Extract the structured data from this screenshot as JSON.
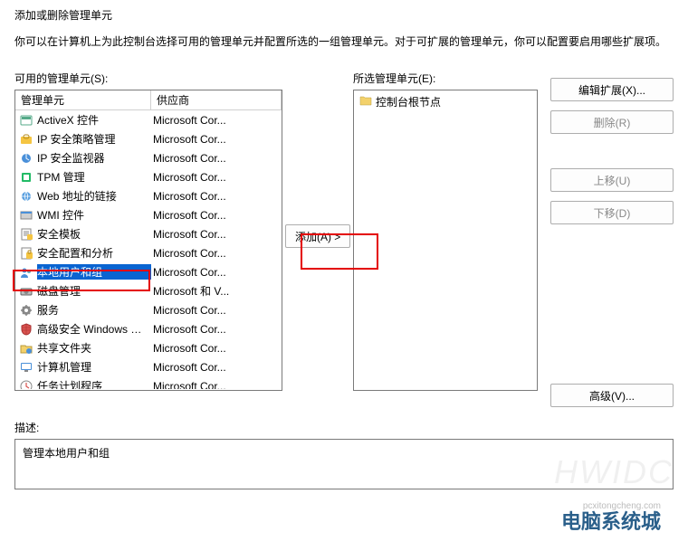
{
  "window_title": "添加或删除管理单元",
  "intro_text": "你可以在计算机上为此控制台选择可用的管理单元并配置所选的一组管理单元。对于可扩展的管理单元，你可以配置要启用哪些扩展项。",
  "labels": {
    "available": "可用的管理单元(S):",
    "selected": "所选管理单元(E):",
    "header_name": "管理单元",
    "header_vendor": "供应商",
    "add_button": "添加(A) >",
    "edit_ext": "编辑扩展(X)...",
    "remove": "删除(R)",
    "move_up": "上移(U)",
    "move_down": "下移(D)",
    "advanced": "高级(V)...",
    "bottom_desc_label": "描述:",
    "desc_text": "管理本地用户和组",
    "console_root": "控制台根节点"
  },
  "snapins": [
    {
      "name": "ActiveX 控件",
      "vendor": "Microsoft Cor...",
      "icon": "activex"
    },
    {
      "name": "IP 安全策略管理",
      "vendor": "Microsoft Cor...",
      "icon": "ipsec"
    },
    {
      "name": "IP 安全监视器",
      "vendor": "Microsoft Cor...",
      "icon": "ipmon"
    },
    {
      "name": "TPM 管理",
      "vendor": "Microsoft Cor...",
      "icon": "tpm"
    },
    {
      "name": "Web 地址的链接",
      "vendor": "Microsoft Cor...",
      "icon": "weblink"
    },
    {
      "name": "WMI 控件",
      "vendor": "Microsoft Cor...",
      "icon": "wmi"
    },
    {
      "name": "安全模板",
      "vendor": "Microsoft Cor...",
      "icon": "sectmpl"
    },
    {
      "name": "安全配置和分析",
      "vendor": "Microsoft Cor...",
      "icon": "secconf"
    },
    {
      "name": "本地用户和组",
      "vendor": "Microsoft Cor...",
      "icon": "lusrmgr",
      "selected": true
    },
    {
      "name": "磁盘管理",
      "vendor": "Microsoft 和 V...",
      "icon": "diskmgr"
    },
    {
      "name": "服务",
      "vendor": "Microsoft Cor...",
      "icon": "services"
    },
    {
      "name": "高级安全 Windows De...",
      "vendor": "Microsoft Cor...",
      "icon": "firewall"
    },
    {
      "name": "共享文件夹",
      "vendor": "Microsoft Cor...",
      "icon": "shared"
    },
    {
      "name": "计算机管理",
      "vendor": "Microsoft Cor...",
      "icon": "compmgmt"
    },
    {
      "name": "任务计划程序",
      "vendor": "Microsoft Cor...",
      "icon": "tasksched"
    }
  ],
  "watermark": "HWIDC",
  "brand": "电脑系统城",
  "brand_sub": "pcxitongcheng.com"
}
